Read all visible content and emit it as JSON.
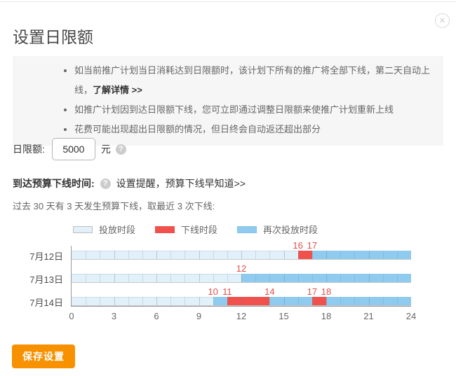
{
  "dialog": {
    "title": "设置日限额",
    "close_glyph": "×"
  },
  "notice": {
    "items": [
      {
        "text": "如当前推广计划当日消耗达到日限额时，该计划下所有的推广将全部下线，第二天自动上线，",
        "link": "了解详情 >>"
      },
      {
        "text": "如推广计划因到达日限额下线，您可立即通过调整日限额来使推广计划重新上线",
        "link": ""
      },
      {
        "text": "花费可能出现超出日限额的情况，但日终会自动返还超出部分",
        "link": ""
      }
    ]
  },
  "form": {
    "label": "日限额:",
    "value": "5000",
    "unit": "元",
    "help_glyph": "?"
  },
  "offline_time": {
    "title": "到达预算下线时间:",
    "help_glyph": "?",
    "reminder_link": "设置提醒，预算下线早知道>>",
    "summary": "过去 30 天有 3 天发生预算下线，取最近 3 次下线:"
  },
  "chart_data": {
    "type": "timeline",
    "x_range": [
      0,
      24
    ],
    "x_ticks": [
      0,
      3,
      6,
      9,
      12,
      15,
      18,
      21,
      24
    ],
    "legend": [
      {
        "type": "delivery",
        "label": "投放时段",
        "color": "#e2f0f9"
      },
      {
        "type": "offline",
        "label": "下线时段",
        "color": "#f0514d"
      },
      {
        "type": "redelivery",
        "label": "再次投放时段",
        "color": "#8ecbee"
      }
    ],
    "rows": [
      {
        "label": "7月12日",
        "markers": [
          16,
          17
        ],
        "segments": [
          {
            "type": "delivery",
            "start": 0,
            "end": 16
          },
          {
            "type": "offline",
            "start": 16,
            "end": 17
          },
          {
            "type": "redelivery",
            "start": 17,
            "end": 24
          }
        ]
      },
      {
        "label": "7月13日",
        "markers": [
          12
        ],
        "segments": [
          {
            "type": "delivery",
            "start": 0,
            "end": 12
          },
          {
            "type": "offline",
            "start": 12,
            "end": 12
          },
          {
            "type": "redelivery",
            "start": 12,
            "end": 24
          }
        ]
      },
      {
        "label": "7月14日",
        "markers": [
          10,
          11,
          14,
          17,
          18
        ],
        "segments": [
          {
            "type": "delivery",
            "start": 0,
            "end": 10
          },
          {
            "type": "offline",
            "start": 10,
            "end": 10
          },
          {
            "type": "redelivery",
            "start": 10,
            "end": 11
          },
          {
            "type": "offline",
            "start": 11,
            "end": 14
          },
          {
            "type": "redelivery",
            "start": 14,
            "end": 17
          },
          {
            "type": "offline",
            "start": 17,
            "end": 18
          },
          {
            "type": "redelivery",
            "start": 18,
            "end": 24
          }
        ]
      }
    ]
  },
  "footer": {
    "save_label": "保存设置"
  },
  "colors": {
    "accent_orange": "#f79100",
    "marker_red": "#e4504a",
    "offline_red": "#f0514d",
    "redelivery_blue": "#8ecbee",
    "delivery_blue": "#e2f0f9"
  }
}
